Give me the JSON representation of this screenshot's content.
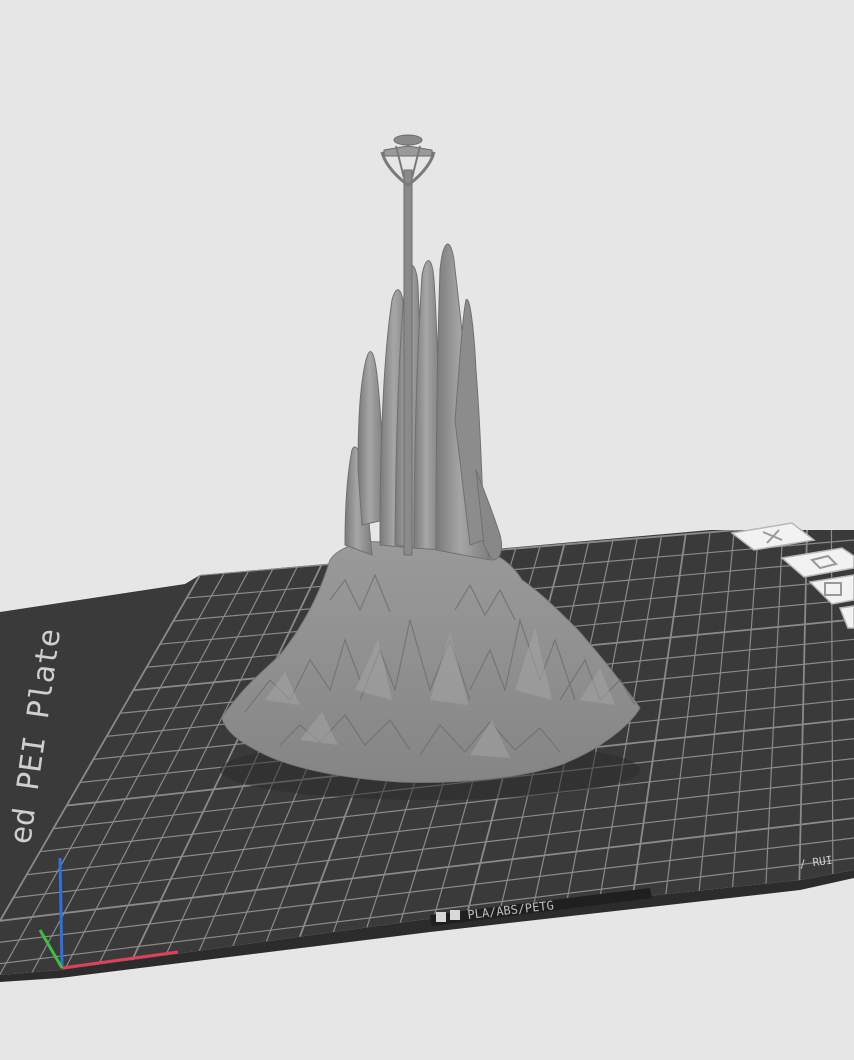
{
  "scene": {
    "plate_label": "Textured PEI Plate",
    "plate_label_visible": "ed PEI Plate",
    "filament_strip": "PLA/ABS/PETG",
    "corner_label": "/ RUI"
  },
  "colors": {
    "background": "#e6e6e6",
    "bed": "#3a3a3a",
    "grid": "#8a8a8a",
    "model": "#8f8f8f",
    "axis_x": "#e0405a",
    "axis_y": "#3fbf3f",
    "axis_z": "#2f6fe0"
  },
  "icons": [
    "close-icon",
    "plate-icon",
    "arrange-icon",
    "layer-icon"
  ]
}
